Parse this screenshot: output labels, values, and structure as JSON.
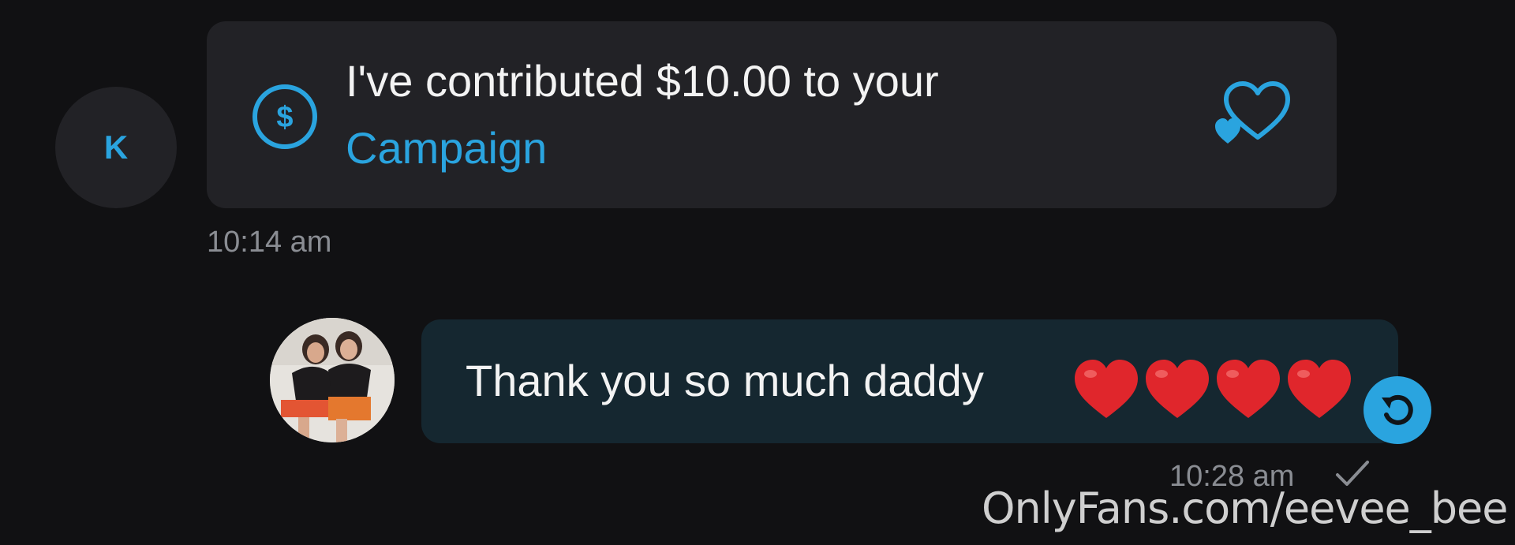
{
  "incoming": {
    "avatar_initial": "K",
    "tip_text": "I've contributed $10.00 to your",
    "tip_link": "Campaign",
    "time": "10:14 am"
  },
  "outgoing": {
    "message": "Thank you so much daddy",
    "emoji_count": 4,
    "time": "10:28 am"
  },
  "watermark": "OnlyFans.com/eevee_bee",
  "colors": {
    "background": "#111113",
    "bubble_in": "#222226",
    "bubble_out": "#152730",
    "accent": "#2aa4df",
    "timestamp": "#8a8d93"
  },
  "icons": [
    "dollar-icon",
    "heart-icon",
    "red-heart-emoji",
    "undo-icon",
    "check-icon"
  ]
}
